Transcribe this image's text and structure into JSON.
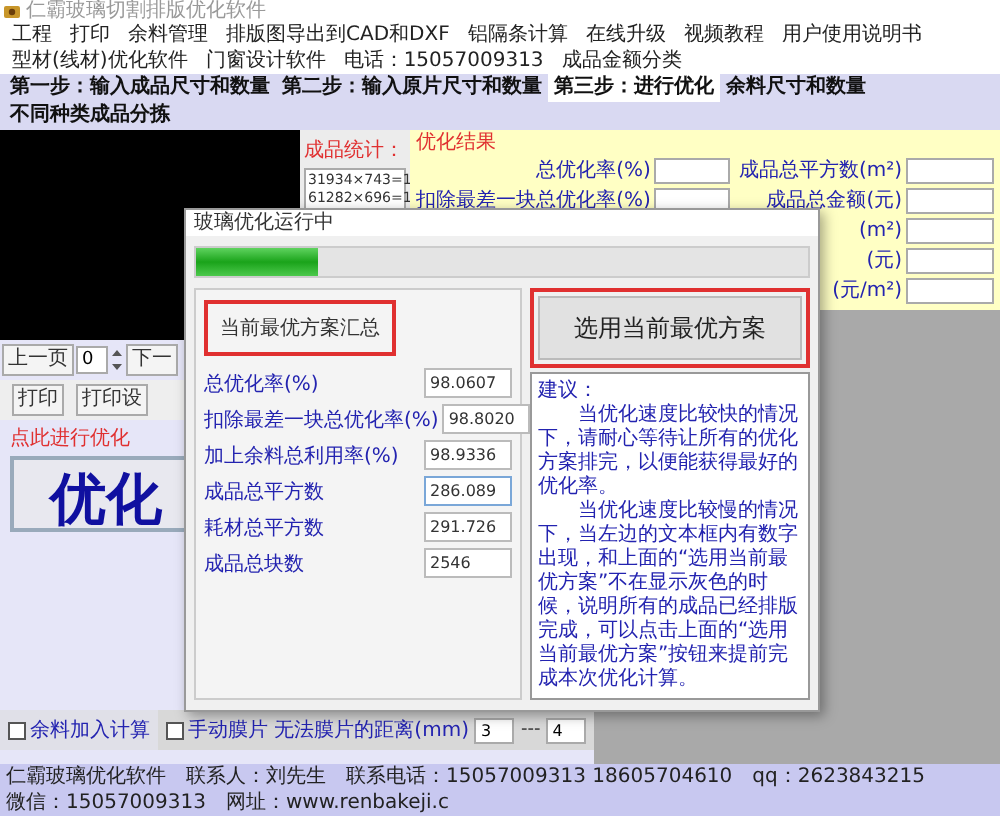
{
  "window": {
    "title": "仁霸玻璃切割排版优化软件"
  },
  "menu": [
    "工程",
    "打印",
    "余料管理",
    "排版图导出到CAD和DXF",
    "铝隔条计算",
    "在线升级",
    "视频教程",
    "用户使用说明书",
    "型材(线材)优化软件",
    "门窗设计软件",
    "电话：15057009313",
    "成品金额分类"
  ],
  "steps": [
    {
      "label": "第一步：输入成品尺寸和数量",
      "selected": false
    },
    {
      "label": "第二步：输入原片尺寸和数量",
      "selected": false
    },
    {
      "label": "第三步：进行优化",
      "selected": true
    },
    {
      "label": "余料尺寸和数量",
      "selected": false
    },
    {
      "label": "不同种类成品分拣",
      "selected": false
    }
  ],
  "left_panel": {
    "pager": {
      "prev": "上一页",
      "page": "0",
      "next": "下一"
    },
    "buttons": [
      "打印",
      "打印设"
    ],
    "hint": "点此进行优化",
    "optimize_button": "优化",
    "remnant_checkbox": {
      "label": "余料加入计算",
      "checked": false
    }
  },
  "stats": {
    "title": "成品统计：",
    "lines": [
      "31934×743=1",
      "61282×696=1"
    ]
  },
  "results": {
    "title": "优化结果",
    "left_fields": [
      {
        "label": "总优化率(%)"
      },
      {
        "label": "扣除最差一块总优化率(%)"
      }
    ],
    "right_fields": [
      {
        "label": "成品总平方数(m²)"
      },
      {
        "label": "成品总金额(元)"
      },
      {
        "label": "(m²)"
      },
      {
        "label": "(元)"
      },
      {
        "label": "(元/m²)"
      }
    ]
  },
  "manual_film": {
    "label": "手动膜片 无法膜片的距离(mm)",
    "checked": false,
    "from": "3",
    "separator": "---",
    "to": "4"
  },
  "dialog": {
    "title": "玻璃优化运行中",
    "progress": {
      "level": 0.2
    },
    "summary_title": "当前最优方案汇总",
    "summary": [
      {
        "label": "总优化率(%)",
        "value": "98.0607"
      },
      {
        "label": "扣除最差一块总优化率(%)",
        "value": "98.8020"
      },
      {
        "label": "加上余料总利用率(%)",
        "value": "98.9336"
      },
      {
        "label": "成品总平方数",
        "value": "286.089"
      },
      {
        "label": "耗材总平方数",
        "value": "291.726"
      },
      {
        "label": "成品总块数",
        "value": "2546"
      }
    ],
    "select_button": "选用当前最优方案",
    "advice_title": "建议：",
    "advice": [
      "当优化速度比较快的情况下，请耐心等待让所有的优化方案排完，以便能获得最好的优化率。",
      "当优化速度比较慢的情况下，当左边的文本框内有数字出现，和上面的“选用当前最优方案”不在显示灰色的时候，说明所有的成品已经排版完成，可以点击上面的“选用当前最优方案”按钮来提前完成本次优化计算。"
    ]
  },
  "status_bar": [
    "仁霸玻璃优化软件",
    "联系人：刘先生",
    "联系电话：15057009313 18605704610",
    "qq：2623843215",
    "微信：15057009313",
    "网址：www.renbakeji.c"
  ]
}
